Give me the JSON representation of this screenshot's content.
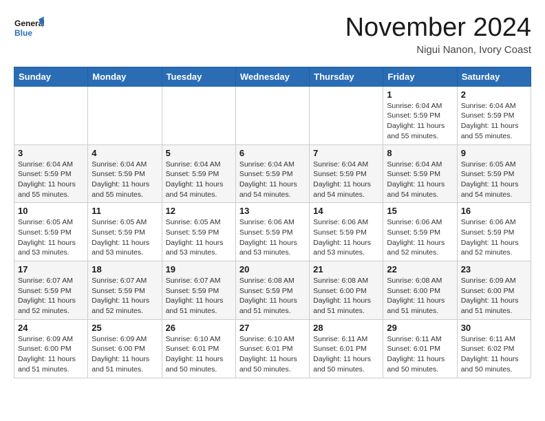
{
  "header": {
    "logo_line1": "General",
    "logo_line2": "Blue",
    "month": "November 2024",
    "location": "Nigui Nanon, Ivory Coast"
  },
  "days_of_week": [
    "Sunday",
    "Monday",
    "Tuesday",
    "Wednesday",
    "Thursday",
    "Friday",
    "Saturday"
  ],
  "weeks": [
    [
      {
        "day": "",
        "info": ""
      },
      {
        "day": "",
        "info": ""
      },
      {
        "day": "",
        "info": ""
      },
      {
        "day": "",
        "info": ""
      },
      {
        "day": "",
        "info": ""
      },
      {
        "day": "1",
        "info": "Sunrise: 6:04 AM\nSunset: 5:59 PM\nDaylight: 11 hours and 55 minutes."
      },
      {
        "day": "2",
        "info": "Sunrise: 6:04 AM\nSunset: 5:59 PM\nDaylight: 11 hours and 55 minutes."
      }
    ],
    [
      {
        "day": "3",
        "info": "Sunrise: 6:04 AM\nSunset: 5:59 PM\nDaylight: 11 hours and 55 minutes."
      },
      {
        "day": "4",
        "info": "Sunrise: 6:04 AM\nSunset: 5:59 PM\nDaylight: 11 hours and 55 minutes."
      },
      {
        "day": "5",
        "info": "Sunrise: 6:04 AM\nSunset: 5:59 PM\nDaylight: 11 hours and 54 minutes."
      },
      {
        "day": "6",
        "info": "Sunrise: 6:04 AM\nSunset: 5:59 PM\nDaylight: 11 hours and 54 minutes."
      },
      {
        "day": "7",
        "info": "Sunrise: 6:04 AM\nSunset: 5:59 PM\nDaylight: 11 hours and 54 minutes."
      },
      {
        "day": "8",
        "info": "Sunrise: 6:04 AM\nSunset: 5:59 PM\nDaylight: 11 hours and 54 minutes."
      },
      {
        "day": "9",
        "info": "Sunrise: 6:05 AM\nSunset: 5:59 PM\nDaylight: 11 hours and 54 minutes."
      }
    ],
    [
      {
        "day": "10",
        "info": "Sunrise: 6:05 AM\nSunset: 5:59 PM\nDaylight: 11 hours and 53 minutes."
      },
      {
        "day": "11",
        "info": "Sunrise: 6:05 AM\nSunset: 5:59 PM\nDaylight: 11 hours and 53 minutes."
      },
      {
        "day": "12",
        "info": "Sunrise: 6:05 AM\nSunset: 5:59 PM\nDaylight: 11 hours and 53 minutes."
      },
      {
        "day": "13",
        "info": "Sunrise: 6:06 AM\nSunset: 5:59 PM\nDaylight: 11 hours and 53 minutes."
      },
      {
        "day": "14",
        "info": "Sunrise: 6:06 AM\nSunset: 5:59 PM\nDaylight: 11 hours and 53 minutes."
      },
      {
        "day": "15",
        "info": "Sunrise: 6:06 AM\nSunset: 5:59 PM\nDaylight: 11 hours and 52 minutes."
      },
      {
        "day": "16",
        "info": "Sunrise: 6:06 AM\nSunset: 5:59 PM\nDaylight: 11 hours and 52 minutes."
      }
    ],
    [
      {
        "day": "17",
        "info": "Sunrise: 6:07 AM\nSunset: 5:59 PM\nDaylight: 11 hours and 52 minutes."
      },
      {
        "day": "18",
        "info": "Sunrise: 6:07 AM\nSunset: 5:59 PM\nDaylight: 11 hours and 52 minutes."
      },
      {
        "day": "19",
        "info": "Sunrise: 6:07 AM\nSunset: 5:59 PM\nDaylight: 11 hours and 51 minutes."
      },
      {
        "day": "20",
        "info": "Sunrise: 6:08 AM\nSunset: 5:59 PM\nDaylight: 11 hours and 51 minutes."
      },
      {
        "day": "21",
        "info": "Sunrise: 6:08 AM\nSunset: 6:00 PM\nDaylight: 11 hours and 51 minutes."
      },
      {
        "day": "22",
        "info": "Sunrise: 6:08 AM\nSunset: 6:00 PM\nDaylight: 11 hours and 51 minutes."
      },
      {
        "day": "23",
        "info": "Sunrise: 6:09 AM\nSunset: 6:00 PM\nDaylight: 11 hours and 51 minutes."
      }
    ],
    [
      {
        "day": "24",
        "info": "Sunrise: 6:09 AM\nSunset: 6:00 PM\nDaylight: 11 hours and 51 minutes."
      },
      {
        "day": "25",
        "info": "Sunrise: 6:09 AM\nSunset: 6:00 PM\nDaylight: 11 hours and 51 minutes."
      },
      {
        "day": "26",
        "info": "Sunrise: 6:10 AM\nSunset: 6:01 PM\nDaylight: 11 hours and 50 minutes."
      },
      {
        "day": "27",
        "info": "Sunrise: 6:10 AM\nSunset: 6:01 PM\nDaylight: 11 hours and 50 minutes."
      },
      {
        "day": "28",
        "info": "Sunrise: 6:11 AM\nSunset: 6:01 PM\nDaylight: 11 hours and 50 minutes."
      },
      {
        "day": "29",
        "info": "Sunrise: 6:11 AM\nSunset: 6:01 PM\nDaylight: 11 hours and 50 minutes."
      },
      {
        "day": "30",
        "info": "Sunrise: 6:11 AM\nSunset: 6:02 PM\nDaylight: 11 hours and 50 minutes."
      }
    ]
  ]
}
